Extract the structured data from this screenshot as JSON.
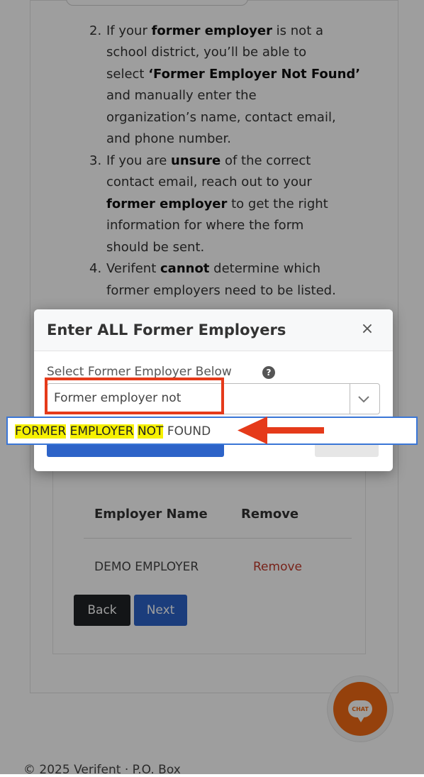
{
  "instructions": {
    "item2": {
      "number": "2.",
      "lines": [
        {
          "before": "If your ",
          "bold": "former employer",
          "after": " is not a"
        },
        {
          "before": "school district, you’ll be able to",
          "bold": "",
          "after": ""
        },
        {
          "before": "select ",
          "bold": "‘Former Employer Not Found’",
          "after": ""
        },
        {
          "before": "and manually enter the",
          "bold": "",
          "after": ""
        },
        {
          "before": "organization’s name, contact email,",
          "bold": "",
          "after": ""
        },
        {
          "before": "and phone number.",
          "bold": "",
          "after": ""
        }
      ]
    },
    "item3": {
      "number": "3.",
      "lines": [
        {
          "before": "If you are ",
          "bold": "unsure",
          "after": " of the correct"
        },
        {
          "before": "contact email, reach out to your",
          "bold": "",
          "after": ""
        },
        {
          "before": "",
          "bold": "former employer",
          "after": " to get the right"
        },
        {
          "before": "information for where the form",
          "bold": "",
          "after": ""
        },
        {
          "before": "should be sent.",
          "bold": "",
          "after": ""
        }
      ]
    },
    "item4": {
      "number": "4.",
      "lines": [
        {
          "before": "Verifent ",
          "bold": "cannot",
          "after": " determine which"
        },
        {
          "before": "former employers need to be listed.",
          "bold": "",
          "after": ""
        }
      ]
    }
  },
  "modal": {
    "title": "Enter ALL Former Employers",
    "close_icon": "×",
    "select_label": "Select Former Employer Below",
    "help_icon": "?",
    "select_value": "Former employer not"
  },
  "dropdown": {
    "option_words_highlighted": [
      "FORMER",
      "EMPLOYER",
      "NOT"
    ],
    "option_word_plain": "FOUND"
  },
  "table": {
    "headers": [
      "Employer Name",
      "Remove"
    ],
    "rows": [
      {
        "employer": "DEMO EMPLOYER",
        "remove": "Remove"
      }
    ]
  },
  "buttons": {
    "back": "Back",
    "next": "Next"
  },
  "chat": {
    "label": "CHAT"
  },
  "footer": {
    "text": "© 2025 Verifent · P.O. Box"
  },
  "colors": {
    "primary": "#2d63c8",
    "dark_button": "#1f2226",
    "remove_link": "#c0392b",
    "chat_orange": "#f06a14",
    "highlight": "#f6f100",
    "annotation_red": "#e53a1a"
  }
}
